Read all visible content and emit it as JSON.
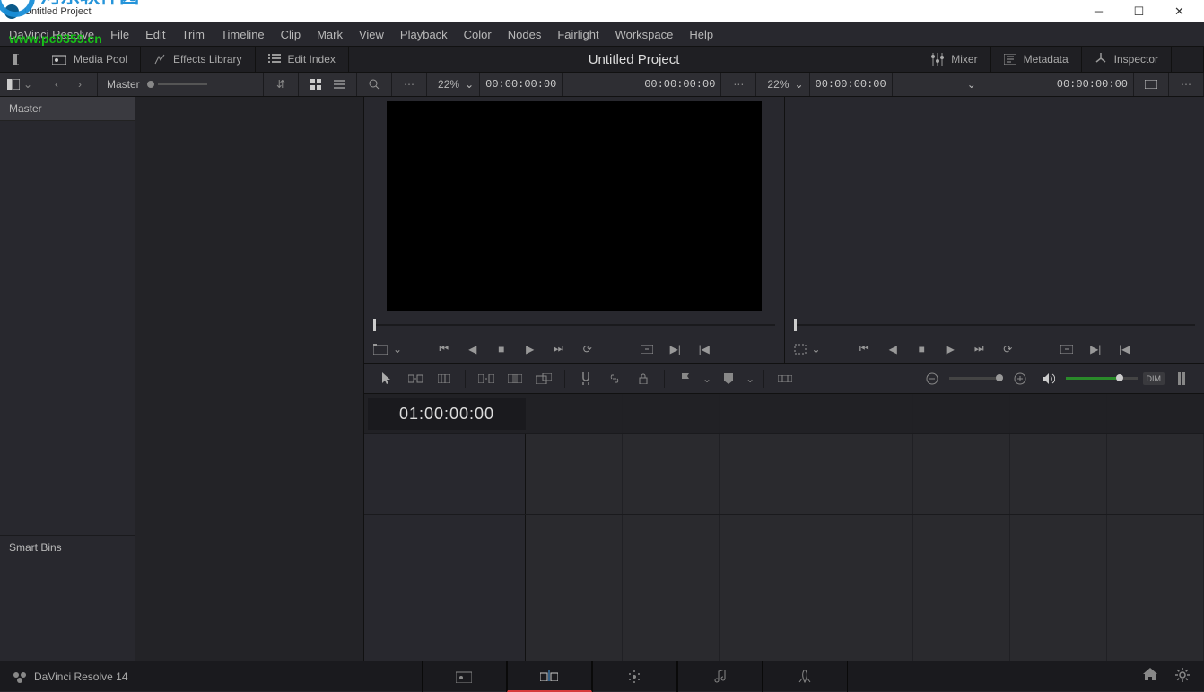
{
  "window": {
    "title": "Untitled Project"
  },
  "watermark": {
    "text": "河东软件园",
    "url": "www.pc0359.cn"
  },
  "menu": [
    "DaVinci Resolve",
    "File",
    "Edit",
    "Trim",
    "Timeline",
    "Clip",
    "Mark",
    "View",
    "Playback",
    "Color",
    "Nodes",
    "Fairlight",
    "Workspace",
    "Help"
  ],
  "panels": {
    "media_pool": "Media Pool",
    "effects": "Effects Library",
    "edit_index": "Edit Index",
    "title": "Untitled Project",
    "mixer": "Mixer",
    "metadata": "Metadata",
    "inspector": "Inspector"
  },
  "browser": {
    "breadcrumb": "Master",
    "folder": "Master",
    "smart_bins": "Smart Bins"
  },
  "source_viewer": {
    "zoom": "22%",
    "tc_left": "00:00:00:00",
    "tc_right": "00:00:00:00"
  },
  "record_viewer": {
    "zoom": "22%",
    "tc_left": "00:00:00:00",
    "tc_right": "00:00:00:00"
  },
  "timeline": {
    "timecode": "01:00:00:00",
    "dim": "DIM"
  },
  "footer": {
    "brand": "DaVinci Resolve 14"
  }
}
